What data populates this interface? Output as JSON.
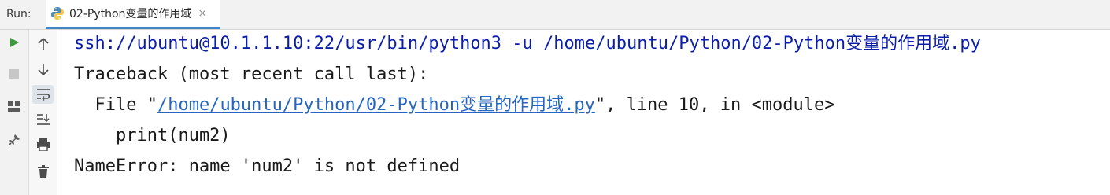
{
  "topbar": {
    "run_label": "Run:",
    "tab_title": "02-Python变量的作用域",
    "tab_close": "×"
  },
  "toolbar_left": [
    "run-icon",
    "stop-icon",
    "layout-icon",
    "pin-icon"
  ],
  "toolbar_second": [
    "arrow-up-icon",
    "arrow-down-icon",
    "soft-wrap-icon",
    "scroll-to-end-icon",
    "print-icon",
    "trash-icon"
  ],
  "console": {
    "command": "ssh://ubuntu@10.1.1.10:22/usr/bin/python3 -u /home/ubuntu/Python/02-Python变量的作用域.py",
    "traceback": "Traceback (most recent call last):",
    "file_prefix": "  File \"",
    "file_link": "/home/ubuntu/Python/02-Python变量的作用域.py",
    "file_suffix": "\", line 10, in <module>",
    "code_line": "    print(num2)",
    "error": "NameError: name 'num2' is not defined"
  },
  "colors": {
    "command": "#0c1ea8",
    "link": "#2466c2",
    "run_green": "#3d9a3d",
    "tab_underline": "#4083c9"
  }
}
